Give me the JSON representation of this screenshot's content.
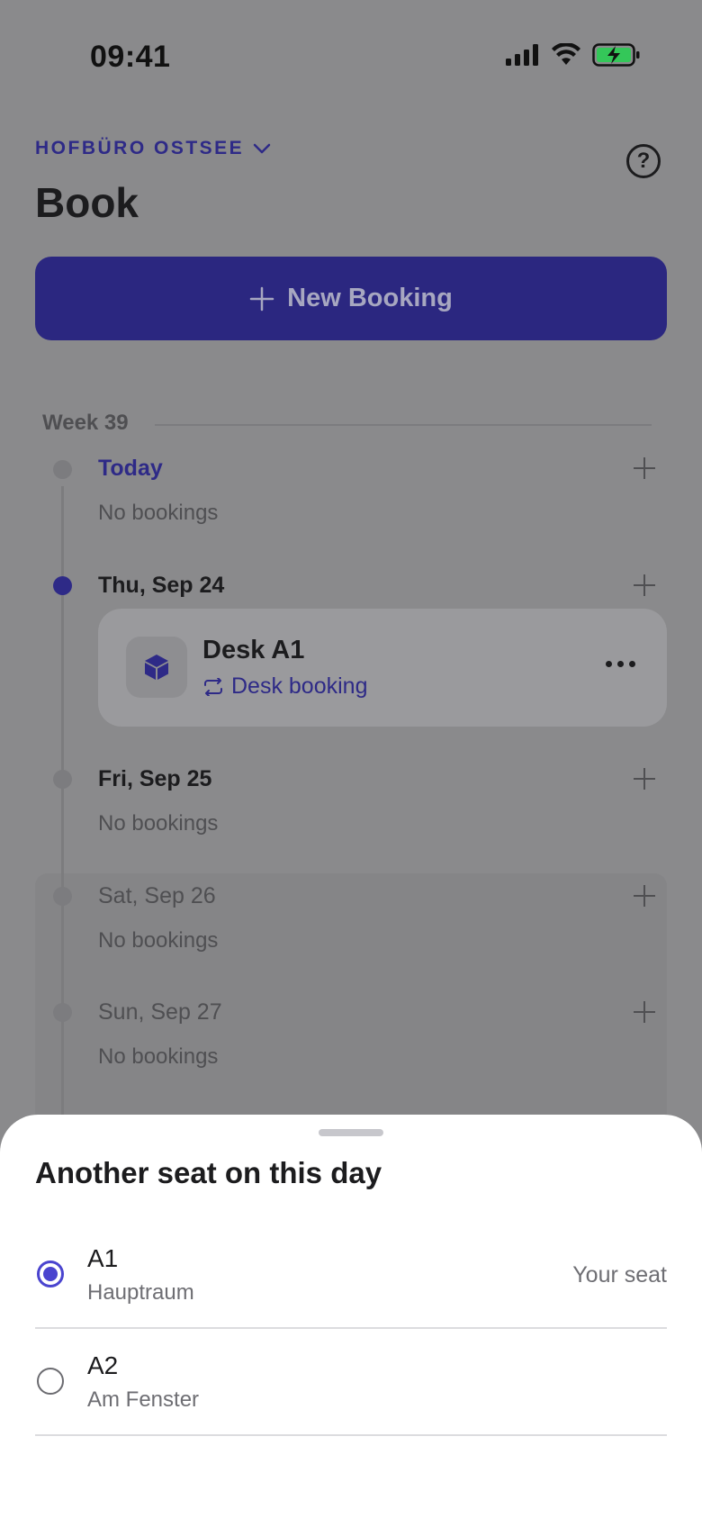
{
  "status_bar": {
    "time": "09:41"
  },
  "header": {
    "location": "HOFBÜRO OSTSEE",
    "title": "Book",
    "new_booking_label": "New Booking"
  },
  "schedule": {
    "week_label": "Week 39",
    "days": [
      {
        "label": "Today",
        "empty_text": "No bookings"
      },
      {
        "label": "Thu, Sep 24"
      },
      {
        "label": "Fri, Sep 25",
        "empty_text": "No bookings"
      },
      {
        "label": "Sat, Sep 26",
        "empty_text": "No bookings"
      },
      {
        "label": "Sun, Sep 27",
        "empty_text": "No bookings"
      }
    ],
    "booking": {
      "title": "Desk A1",
      "subtitle": "Desk booking"
    }
  },
  "sheet": {
    "title": "Another seat on this day",
    "seats": [
      {
        "name": "A1",
        "room": "Hauptraum",
        "tag": "Your seat",
        "selected": true
      },
      {
        "name": "A2",
        "room": "Am Fenster",
        "tag": "",
        "selected": false
      }
    ]
  },
  "colors": {
    "accent": "#2e2a87",
    "radio_selected": "#4a44cf",
    "battery_green": "#34c759"
  }
}
